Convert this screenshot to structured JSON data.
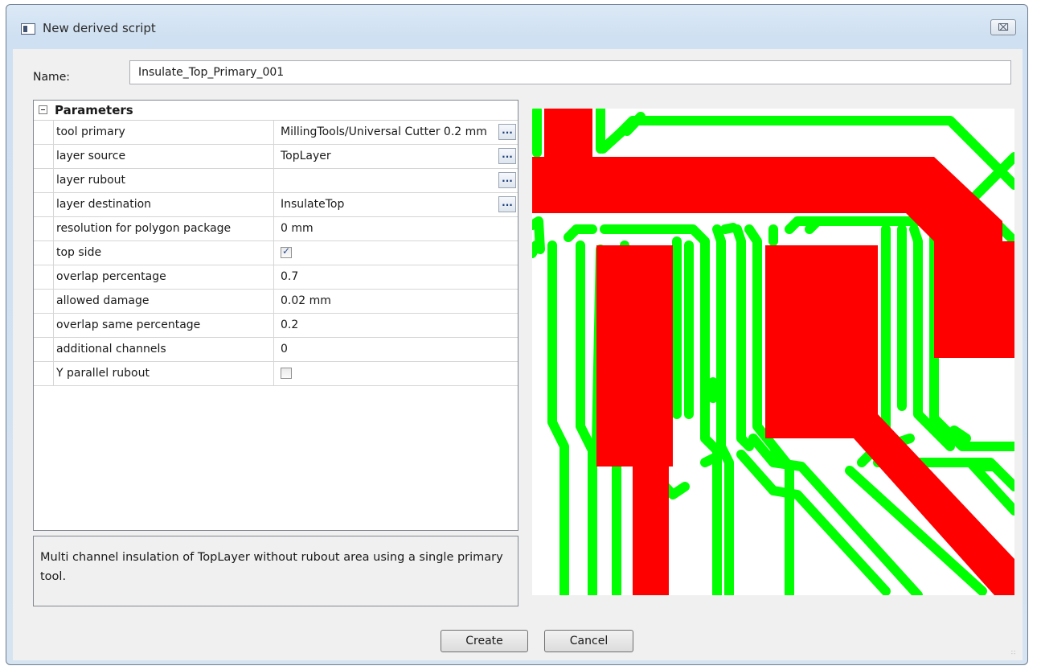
{
  "window": {
    "title": "New derived script",
    "close_glyph": "⌧"
  },
  "name_field": {
    "label": "Name:",
    "value": "Insulate_Top_Primary_001"
  },
  "parameters": {
    "header": "Parameters",
    "rows": [
      {
        "name": "tool primary",
        "value": "MillingTools/Universal Cutter 0.2 mm",
        "has_button": true
      },
      {
        "name": "layer source",
        "value": "TopLayer",
        "has_button": true
      },
      {
        "name": "layer rubout",
        "value": "",
        "has_button": true
      },
      {
        "name": "layer destination",
        "value": "InsulateTop",
        "has_button": true
      },
      {
        "name": "resolution for polygon package",
        "value": "0 mm"
      },
      {
        "name": "top side",
        "checkbox": true,
        "checked": true
      },
      {
        "name": "overlap percentage",
        "value": "0.7"
      },
      {
        "name": "allowed damage",
        "value": "0.02 mm"
      },
      {
        "name": "overlap same percentage",
        "value": "0.2"
      },
      {
        "name": "additional channels",
        "value": "0"
      },
      {
        "name": "Y parallel rubout",
        "checkbox": true,
        "checked": false
      }
    ],
    "button_glyph": "..."
  },
  "description": "Multi channel insulation of TopLayer without rubout area using a single primary tool.",
  "buttons": {
    "create": "Create",
    "cancel": "Cancel"
  },
  "preview_colors": {
    "copper": "#ff0000",
    "insulation": "#00ff00",
    "background": "#ffffff"
  }
}
